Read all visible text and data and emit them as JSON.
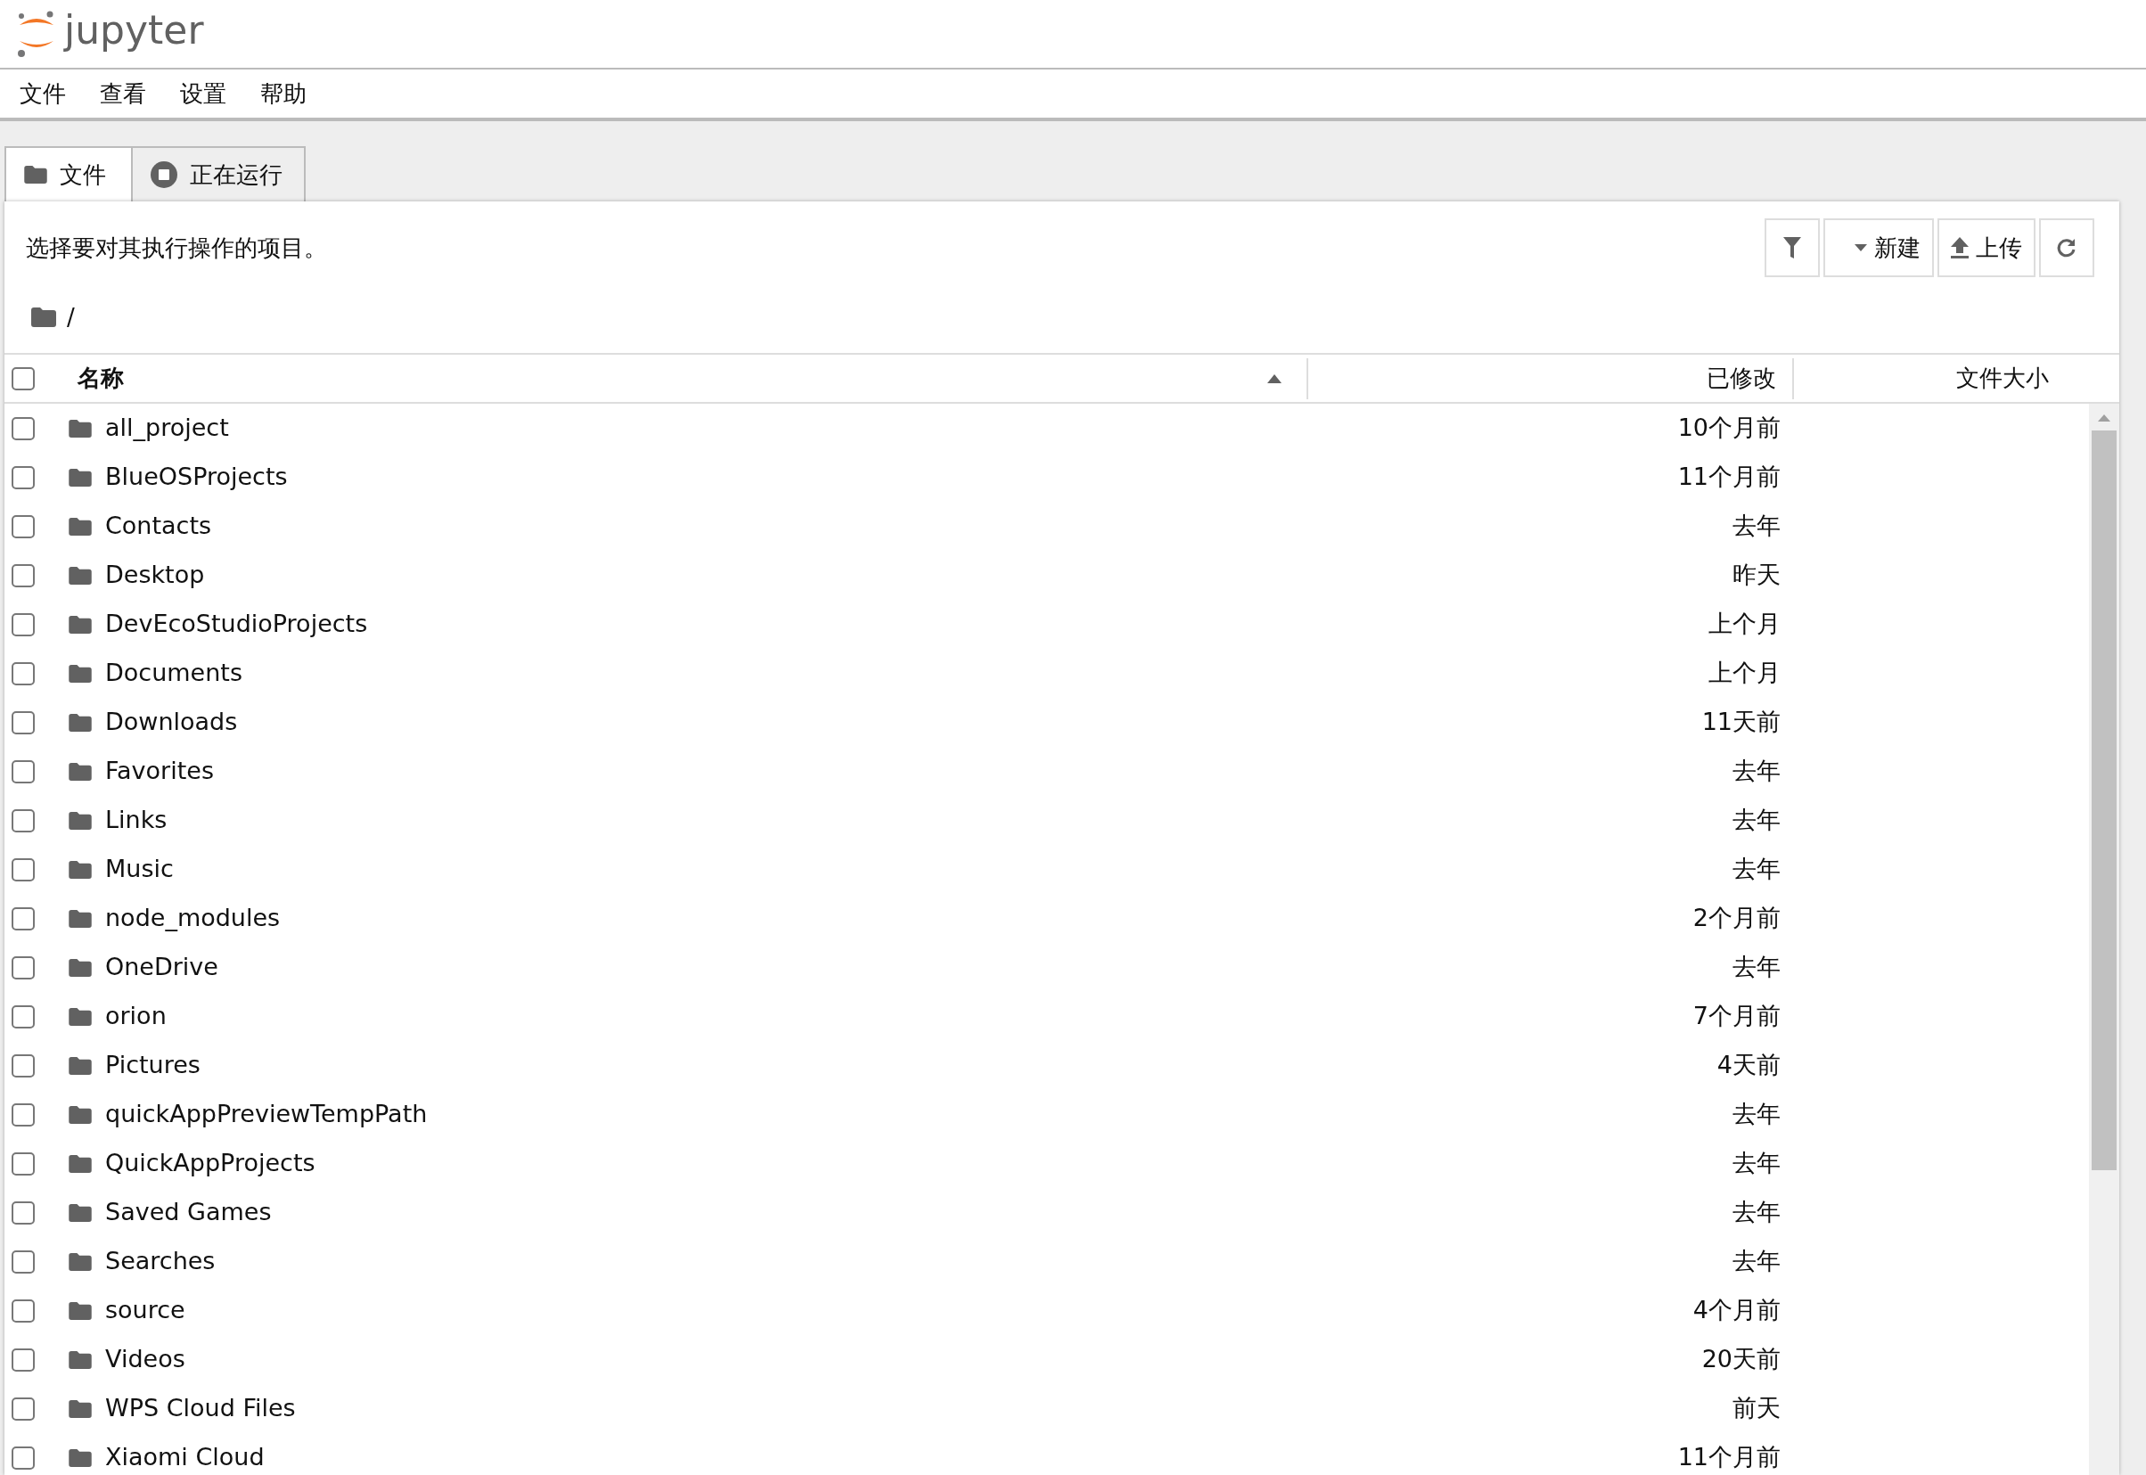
{
  "header": {
    "logo_text": "jupyter"
  },
  "menu": [
    "文件",
    "查看",
    "设置",
    "帮助"
  ],
  "tabs": [
    {
      "label": "文件",
      "kind": "folder",
      "selected": true
    },
    {
      "label": "正在运行",
      "kind": "stop",
      "selected": false
    }
  ],
  "toolbar": {
    "hint": "选择要对其执行操作的项目。",
    "buttons": [
      {
        "kind": "filter"
      },
      {
        "kind": "dropdown",
        "label": "新建"
      },
      {
        "kind": "upload",
        "label": "上传"
      },
      {
        "kind": "refresh"
      }
    ]
  },
  "breadcrumb": "/",
  "table": {
    "columns": [
      {
        "label": "名称",
        "sorted": true
      },
      {
        "label": "已修改",
        "sorted": false
      },
      {
        "label": "文件大小",
        "sorted": false
      }
    ],
    "all_checked": false,
    "rows": [
      {
        "name": "all_project",
        "modified": "10个月前",
        "checked": false
      },
      {
        "name": "BlueOSProjects",
        "modified": "11个月前",
        "checked": false
      },
      {
        "name": "Contacts",
        "modified": "去年",
        "checked": false
      },
      {
        "name": "Desktop",
        "modified": "昨天",
        "checked": false
      },
      {
        "name": "DevEcoStudioProjects",
        "modified": "上个月",
        "checked": false
      },
      {
        "name": "Documents",
        "modified": "上个月",
        "checked": false
      },
      {
        "name": "Downloads",
        "modified": "11天前",
        "checked": false
      },
      {
        "name": "Favorites",
        "modified": "去年",
        "checked": false
      },
      {
        "name": "Links",
        "modified": "去年",
        "checked": false
      },
      {
        "name": "Music",
        "modified": "去年",
        "checked": false
      },
      {
        "name": "node_modules",
        "modified": "2个月前",
        "checked": false
      },
      {
        "name": "OneDrive",
        "modified": "去年",
        "checked": false
      },
      {
        "name": "orion",
        "modified": "7个月前",
        "checked": false
      },
      {
        "name": "Pictures",
        "modified": "4天前",
        "checked": false
      },
      {
        "name": "quickAppPreviewTempPath",
        "modified": "去年",
        "checked": false
      },
      {
        "name": "QuickAppProjects",
        "modified": "去年",
        "checked": false
      },
      {
        "name": "Saved Games",
        "modified": "去年",
        "checked": false
      },
      {
        "name": "Searches",
        "modified": "去年",
        "checked": false
      },
      {
        "name": "source",
        "modified": "4个月前",
        "checked": false
      },
      {
        "name": "Videos",
        "modified": "20天前",
        "checked": false
      },
      {
        "name": "WPS Cloud Files",
        "modified": "前天",
        "checked": false
      },
      {
        "name": "Xiaomi Cloud",
        "modified": "11个月前",
        "checked": false
      }
    ]
  }
}
